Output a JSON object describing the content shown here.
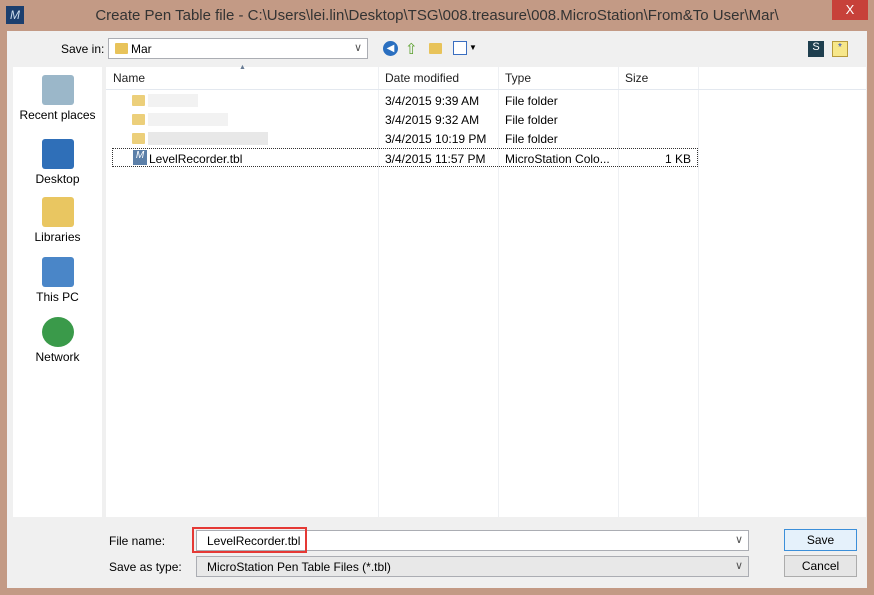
{
  "window": {
    "title": "Create Pen Table file - C:\\Users\\lei.lin\\Desktop\\TSG\\008.treasure\\008.MicroStation\\From&To User\\Mar\\",
    "close": "X"
  },
  "toolbar": {
    "save_in_label": "Save in:",
    "save_in_value": "Mar"
  },
  "places": [
    {
      "label": "Recent places",
      "icon": "recent-places-icon"
    },
    {
      "label": "Desktop",
      "icon": "desktop-icon"
    },
    {
      "label": "Libraries",
      "icon": "libraries-icon"
    },
    {
      "label": "This PC",
      "icon": "this-pc-icon"
    },
    {
      "label": "Network",
      "icon": "network-icon"
    }
  ],
  "columns": [
    "Name",
    "Date modified",
    "Type",
    "Size"
  ],
  "rows": [
    {
      "name": "",
      "date": "3/4/2015 9:39 AM",
      "type": "File folder",
      "size": ""
    },
    {
      "name": "",
      "date": "3/4/2015 9:32 AM",
      "type": "File folder",
      "size": ""
    },
    {
      "name": "",
      "date": "3/4/2015 10:19 PM",
      "type": "File folder",
      "size": ""
    },
    {
      "name": "LevelRecorder.tbl",
      "date": "3/4/2015 11:57 PM",
      "type": "MicroStation Colo...",
      "size": "1 KB"
    }
  ],
  "footer": {
    "file_name_label": "File name:",
    "file_name_value": "LevelRecorder.tbl",
    "type_label": "Save as type:",
    "type_value": "MicroStation Pen Table Files (*.tbl)",
    "save": "Save",
    "cancel": "Cancel"
  },
  "colors": {
    "frame": "#c39a85",
    "close": "#c7413a",
    "highlight": "#e53935"
  }
}
